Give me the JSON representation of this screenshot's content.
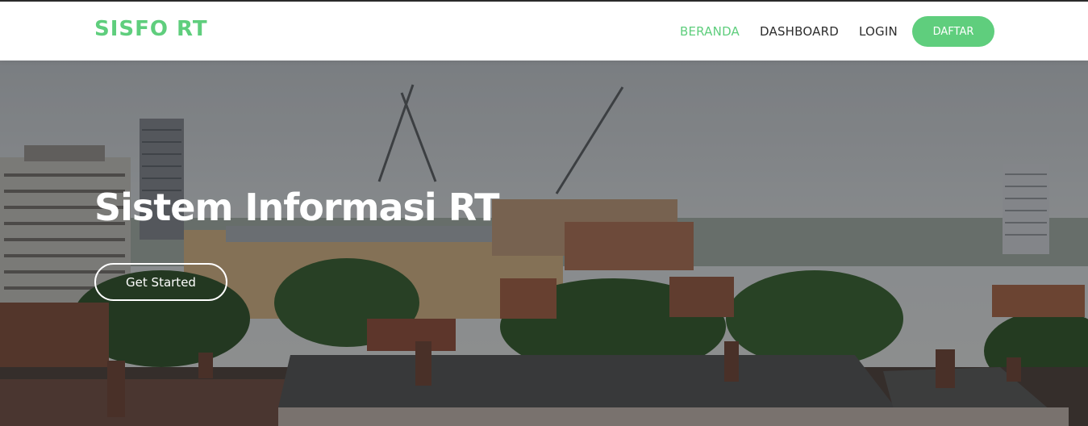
{
  "brand": "SISFO RT",
  "nav": {
    "beranda": "BERANDA",
    "dashboard": "DASHBOARD",
    "login": "LOGIN",
    "daftar": "DAFTAR"
  },
  "hero": {
    "title": "Sistem Informasi RT",
    "cta": "Get Started"
  },
  "colors": {
    "accent": "#5fce7d",
    "nav_text": "#2d2d2d",
    "hero_text": "#ffffff"
  }
}
